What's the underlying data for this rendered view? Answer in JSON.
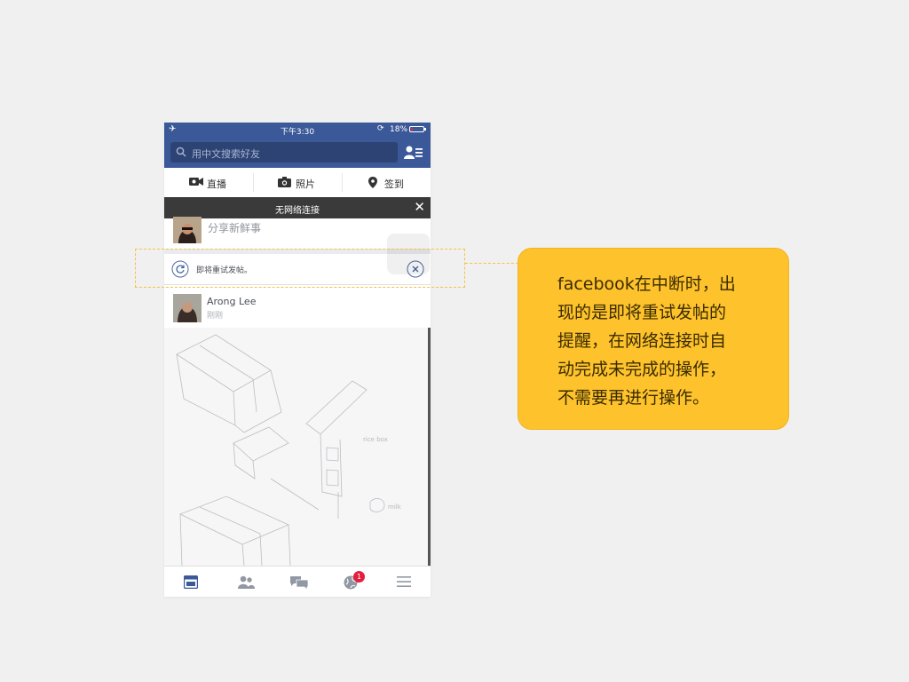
{
  "status_bar": {
    "time": "下午3:30",
    "battery": "18%",
    "battery_level": 0.18
  },
  "search": {
    "placeholder": "用中文搜索好友"
  },
  "actions": [
    {
      "label": "直播",
      "icon": "live-video-icon"
    },
    {
      "label": "照片",
      "icon": "camera-icon"
    },
    {
      "label": "签到",
      "icon": "location-pin-icon"
    }
  ],
  "offline_banner": {
    "text": "无网络连接",
    "close_icon": "close-icon"
  },
  "composer": {
    "prompt": "分享新鲜事"
  },
  "retry_banner": {
    "text": "即将重试发帖。",
    "icon": "refresh-icon",
    "dismiss_icon": "close-circle-icon"
  },
  "post": {
    "author": "Arong Lee",
    "time": "刚刚"
  },
  "sketch_labels": {
    "a": "rice box",
    "b": "milk"
  },
  "tabs": [
    {
      "icon": "news-feed-icon",
      "active": true
    },
    {
      "icon": "friend-requests-icon",
      "active": false
    },
    {
      "icon": "messages-icon",
      "active": false
    },
    {
      "icon": "notifications-globe-icon",
      "active": false,
      "badge": "1"
    },
    {
      "icon": "menu-icon",
      "active": false
    }
  ],
  "annotation": {
    "lines": [
      "facebook在中断时，出",
      "现的是即将重试发帖的",
      "提醒，在网络连接时自",
      "动完成未完成的操作，",
      "不需要再进行操作。"
    ]
  },
  "colors": {
    "brand": "#3b5998",
    "accent_yellow": "#fdc22c",
    "badge_red": "#e41e3f",
    "offline_bar": "#3a3a3a"
  }
}
